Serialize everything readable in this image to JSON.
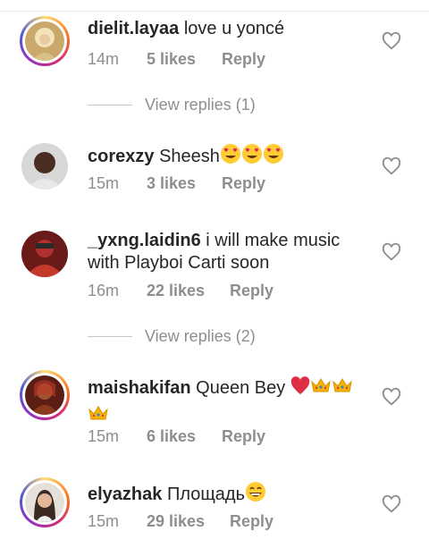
{
  "comments": [
    {
      "username": "dielit.layaa",
      "text": "love u yoncé",
      "time": "14m",
      "likes": "5 likes",
      "reply": "Reply"
    },
    {
      "username": "corexzy",
      "text": "Sheesh",
      "time": "15m",
      "likes": "3 likes",
      "reply": "Reply",
      "emoji": [
        "heart-eyes",
        "heart-eyes",
        "heart-eyes"
      ]
    },
    {
      "username": "_yxng.laidin6",
      "text": "i will make music with Playboi Carti soon",
      "time": "16m",
      "likes": "22 likes",
      "reply": "Reply"
    },
    {
      "username": "maishakifan",
      "text": "Queen Bey",
      "time": "15m",
      "likes": "6 likes",
      "reply": "Reply",
      "emoji": [
        "red-heart",
        "crown",
        "crown",
        "crown"
      ]
    },
    {
      "username": "elyazhak",
      "text": "Площадь",
      "time": "15m",
      "likes": "29 likes",
      "reply": "Reply",
      "emoji": [
        "grinning-face"
      ]
    }
  ],
  "view_replies": [
    {
      "label": "View replies (1)"
    },
    {
      "label": "View replies (2)"
    }
  ],
  "icons": {
    "like": "heart-outline-icon"
  },
  "colors": {
    "text": "#262626",
    "meta": "#8e8e8e",
    "divider": "#c7c7c7"
  }
}
